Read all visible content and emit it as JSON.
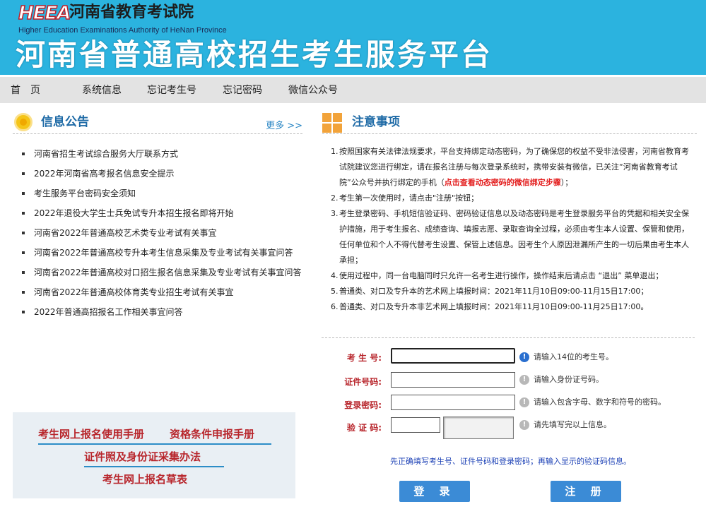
{
  "header": {
    "logo_text": "HEEA",
    "org_name": "河南省教育考试院",
    "org_name_en": "Higher Education Examinations Authority of HeNan Province",
    "platform_title": "河南省普通高校招生考生服务平台"
  },
  "nav": {
    "items": [
      "首　页",
      "系统信息",
      "忘记考生号",
      "忘记密码",
      "微信公众号"
    ]
  },
  "announcements": {
    "title": "信息公告",
    "more_label": "更多 >>",
    "items": [
      "河南省招生考试综合服务大厅联系方式",
      "2022年河南省高考报名信息安全提示",
      "考生服务平台密码安全须知",
      "2022年退役大学生士兵免试专升本招生报名即将开始",
      "河南省2022年普通高校艺术类专业考试有关事宜",
      "河南省2022年普通高校专升本考生信息采集及专业考试有关事宜问答",
      "河南省2022年普通高校对口招生报名信息采集及专业考试有关事宜问答",
      "河南省2022年普通高校体育类专业招生考试有关事宜",
      "2022年普通高招报名工作相关事宜问答"
    ]
  },
  "manuals": {
    "user_manual": "考生网上报名使用手册",
    "qualification_manual": "资格条件申报手册",
    "photo_method": "证件照及身份证采集办法",
    "draft": "考生网上报名草表"
  },
  "notice": {
    "title": "注意事项",
    "item1_a": "按照国家有关法律法规要求，平台支持绑定动态密码，为了确保您的权益不受非法侵害，河南省教育考试院建议您进行绑定，请在报名注册与每次登录系统时，携带安装有微信，已关注“河南省教育考试院”公众号并执行绑定的手机（",
    "item1_link": "点击查看动态密码的微信绑定步骤",
    "item1_b": "）；",
    "item2": "考生第一次使用时，请点击\"注册\"按钮；",
    "item3": "考生登录密码、手机短信验证码、密码验证信息以及动态密码是考生登录服务平台的凭据和相关安全保护措施，用于考生报名、成绩查询、填报志愿、录取查询全过程，必须由考生本人设置、保管和使用，任何单位和个人不得代替考生设置、保管上述信息。因考生个人原因泄漏所产生的一切后果由考生本人承担；",
    "item4": "使用过程中，同一台电脑同时只允许一名考生进行操作，操作结束后请点击 “退出” 菜单退出；",
    "item5": "普通类、对口及专升本的艺术网上填报时间：2021年11月10日09:00-11月15日17:00；",
    "item6": "普通类、对口及专升本非艺术网上填报时间：2021年11月10日09:00-11月25日17:00。"
  },
  "login": {
    "exam_no_label": "考 生 号:",
    "exam_no_hint": "请输入14位的考生号。",
    "id_label": "证件号码:",
    "id_hint": "请输入身份证号码。",
    "password_label": "登录密码:",
    "password_hint": "请输入包含字母、数字和符号的密码。",
    "captcha_label": "验 证 码:",
    "captcha_hint": "请先填写完以上信息。",
    "tip": "先正确填写考生号、证件号码和登录密码；再输入显示的验证码信息。",
    "login_button": "登 录",
    "register_button": "注 册"
  },
  "colors": {
    "banner": "#2bb3df",
    "nav_bg": "#e3e3e3",
    "section_title": "#1e6aa6",
    "label_red": "#b8262c",
    "button_blue": "#3b8bd6",
    "tip_blue": "#1a3fb5"
  },
  "icons": [
    "sun-icon",
    "grid-icon",
    "info-icon"
  ]
}
